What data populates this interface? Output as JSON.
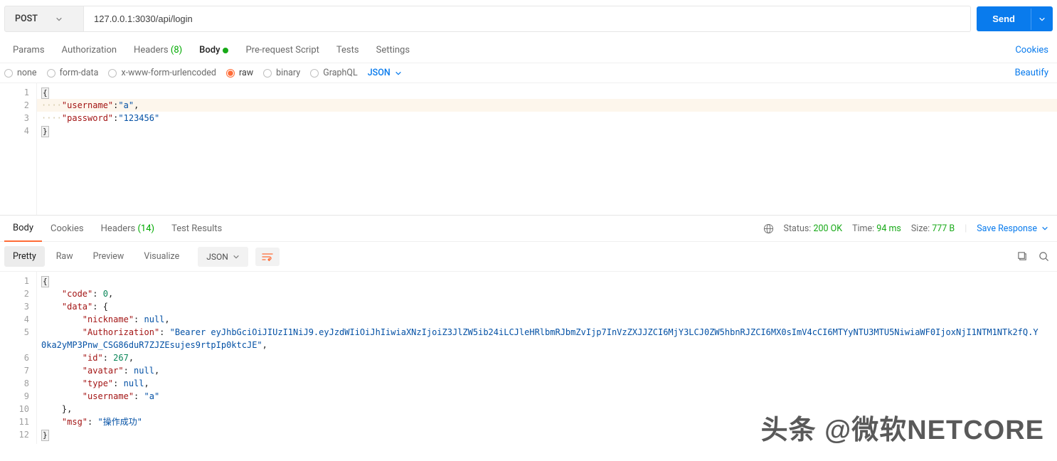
{
  "request": {
    "method": "POST",
    "url": "127.0.0.1:3030/api/login",
    "send_label": "Send"
  },
  "tabs": {
    "params": "Params",
    "authorization": "Authorization",
    "headers": "Headers",
    "headers_count": "(8)",
    "body": "Body",
    "prerequest": "Pre-request Script",
    "tests": "Tests",
    "settings": "Settings",
    "cookies_link": "Cookies"
  },
  "body_types": {
    "none": "none",
    "formdata": "form-data",
    "xwww": "x-www-form-urlencoded",
    "raw": "raw",
    "binary": "binary",
    "graphql": "GraphQL",
    "format": "JSON",
    "beautify": "Beautify"
  },
  "req_body": {
    "l1": "{",
    "l2_key": "\"username\"",
    "l2_val": "\"a\"",
    "l3_key": "\"password\"",
    "l3_val": "\"123456\"",
    "l4": "}"
  },
  "resp_tabs": {
    "body": "Body",
    "cookies": "Cookies",
    "headers": "Headers",
    "headers_count": "(14)",
    "tests": "Test Results",
    "status_lbl": "Status:",
    "status_val": "200 OK",
    "time_lbl": "Time:",
    "time_val": "94 ms",
    "size_lbl": "Size:",
    "size_val": "777 B",
    "save": "Save Response"
  },
  "resp_views": {
    "pretty": "Pretty",
    "raw": "Raw",
    "preview": "Preview",
    "visualize": "Visualize",
    "format": "JSON"
  },
  "resp_body": {
    "l1": "{",
    "l2_key": "\"code\"",
    "l2_val": "0",
    "l3_key": "\"data\"",
    "l3_val": "{",
    "l4_key": "\"nickname\"",
    "l4_val": "null",
    "l5_key": "\"Authorization\"",
    "l5_val": "\"Bearer eyJhbGciOiJIUzI1NiJ9.eyJzdWIiOiJhIiwiaXNzIjoiZ3JlZW5ib24iLCJleHRlbmRJbmZvIjp7InVzZXJJZCI6MjY3LCJ0ZW5hbnRJZCI6MX0sImV4cCI6MTYyNTU3MTU5NiwiaWF0IjoxNjI1NTM1NTk2fQ.Y0ka2yMP3Pnw_CSG86duR7ZJZEsujes9rtpIp0ktcJE\"",
    "l6_key": "\"id\"",
    "l6_val": "267",
    "l7_key": "\"avatar\"",
    "l7_val": "null",
    "l8_key": "\"type\"",
    "l8_val": "null",
    "l9_key": "\"username\"",
    "l9_val": "\"a\"",
    "l10": "}",
    "l11_key": "\"msg\"",
    "l11_val": "\"操作成功\"",
    "l12": "}"
  },
  "watermark": "头条 @微软NETCORE"
}
